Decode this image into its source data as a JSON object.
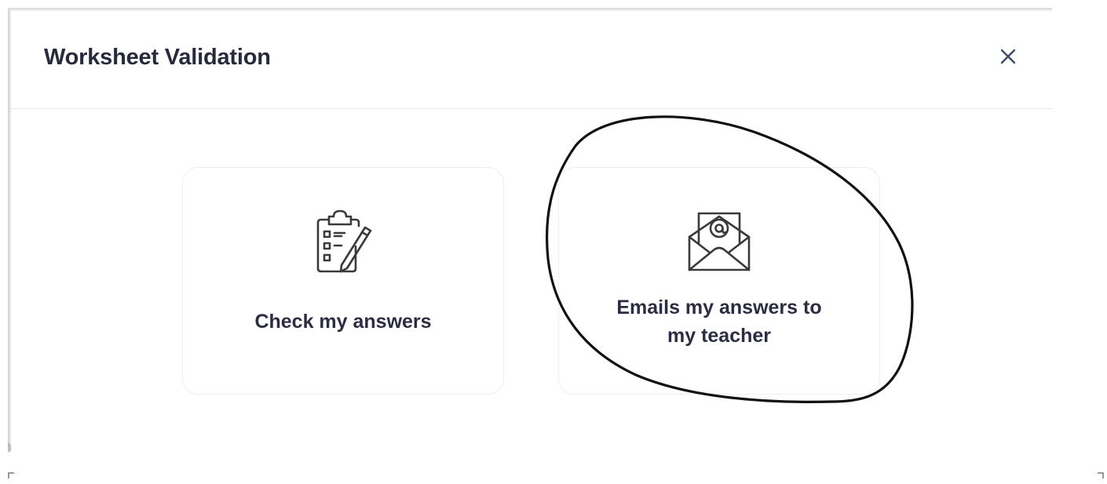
{
  "dialog": {
    "title": "Worksheet Validation",
    "close_icon": "close-icon"
  },
  "options": [
    {
      "label": "Check my answers",
      "icon": "clipboard-checklist-icon"
    },
    {
      "label": "Emails my answers to my teacher",
      "icon": "email-envelope-icon"
    }
  ],
  "colors": {
    "title_text": "#272a3d",
    "card_text": "#2b2d42",
    "card_border": "#eceef2",
    "icon_stroke": "#3a3a3a",
    "annotation_ink": "#111111"
  }
}
